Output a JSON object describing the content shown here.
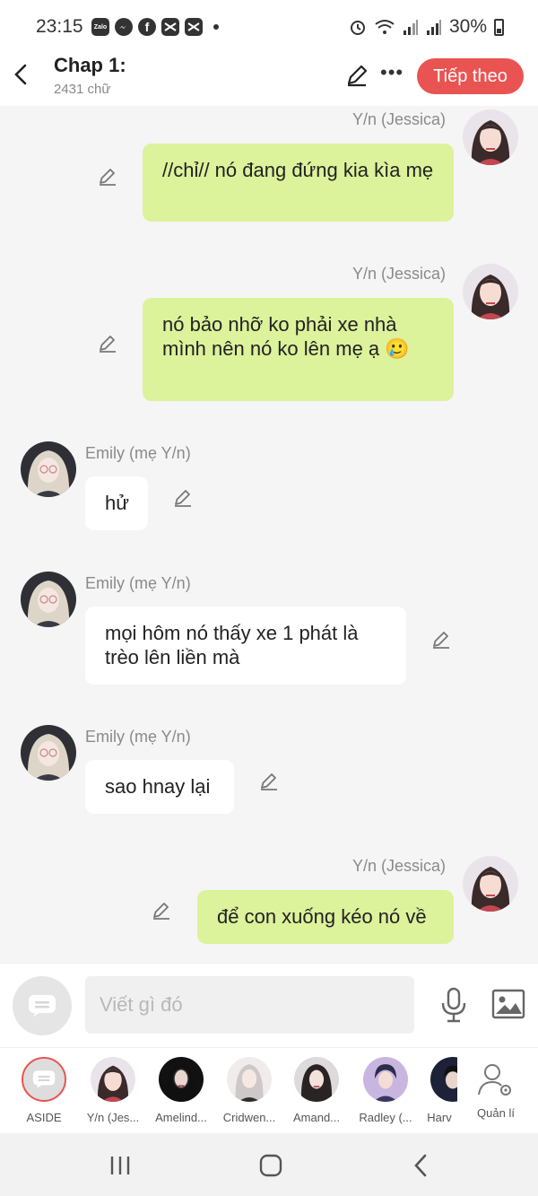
{
  "status_bar": {
    "time": "23:15",
    "app_icons": [
      "zalo-icon",
      "messenger-icon",
      "facebook-icon",
      "capcut-icon",
      "capcut-icon"
    ],
    "battery": "30%"
  },
  "header": {
    "title": "Chap 1:",
    "word_count": "2431 chữ",
    "next_label": "Tiếp theo"
  },
  "messages": [
    {
      "side": "right",
      "name": "Y/n (Jessica)",
      "text": "//chỉ// nó đang đứng kia kìa mẹ"
    },
    {
      "side": "right",
      "name": "Y/n (Jessica)",
      "text": "nó bảo nhỡ ko phải xe nhà mình nên nó ko lên mẹ ạ 🥲"
    },
    {
      "side": "left",
      "name": "Emily (mẹ Y/n)",
      "text": "hử"
    },
    {
      "side": "left",
      "name": "Emily (mẹ Y/n)",
      "text": "mọi hôm nó thấy xe 1 phát là trèo lên liền mà"
    },
    {
      "side": "left",
      "name": "Emily (mẹ Y/n)",
      "text": "sao hnay lại"
    },
    {
      "side": "right",
      "name": "Y/n (Jessica)",
      "text": "để con xuống kéo nó về"
    }
  ],
  "composer": {
    "placeholder": "Viết gì đó"
  },
  "characters": [
    {
      "label": "ASIDE"
    },
    {
      "label": "Y/n (Jes..."
    },
    {
      "label": "Amelind..."
    },
    {
      "label": "Cridwen..."
    },
    {
      "label": "Amand..."
    },
    {
      "label": "Radley (..."
    },
    {
      "label": "Harv"
    },
    {
      "label": "Quản lí"
    }
  ],
  "colors": {
    "accent": "#e95452",
    "bubble_right": "#dcf29b",
    "bubble_left": "#ffffff",
    "background": "#f5f5f5"
  }
}
